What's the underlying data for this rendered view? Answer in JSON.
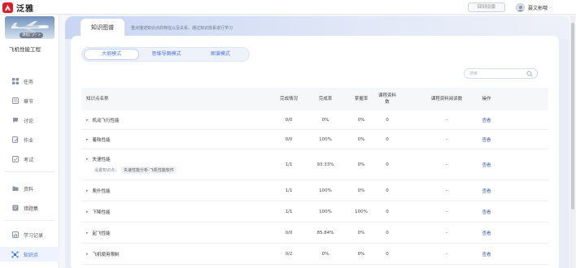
{
  "app": {
    "logo_text": "泛雅"
  },
  "topbar": {
    "back_label": "回到旧版",
    "user_name": "聂文彬哦"
  },
  "sidebar": {
    "course_pill": "课程门户 >",
    "course_title": "飞机性能工程",
    "items": [
      {
        "label": "任务",
        "icon": "grid-icon"
      },
      {
        "label": "章节",
        "icon": "book-icon"
      },
      {
        "label": "讨论",
        "icon": "chat-icon"
      },
      {
        "label": "作业",
        "icon": "edit-icon"
      },
      {
        "label": "考试",
        "icon": "exam-icon"
      },
      {
        "label": "资料",
        "icon": "folder-icon"
      },
      {
        "label": "错题集",
        "icon": "book-icon"
      },
      {
        "label": "学习记录",
        "icon": "record-icon"
      },
      {
        "label": "知识点",
        "icon": "knowledge-icon",
        "active": true
      }
    ]
  },
  "main": {
    "tab_label": "知识图谱",
    "tab_desc": "重点描述知识点的特征以及关系，通过知识体系进行学习",
    "modes": [
      "大纲模式",
      "思维导图模式",
      "图谱模式"
    ],
    "selected_mode": "大纲模式",
    "search_placeholder": "搜索"
  },
  "table": {
    "headers": [
      "知识点名称",
      "完成情况",
      "完成率",
      "掌握率",
      "课程资料数",
      "课程资料阅读数",
      "操作"
    ],
    "rows": [
      {
        "name": "机动飞行性能",
        "done": "0/0",
        "rate": "0%",
        "mastery": "0%",
        "materials": "0",
        "reads": "-",
        "action": "查看"
      },
      {
        "name": "着陆性能",
        "done": "0/0",
        "rate": "100%",
        "mastery": "0%",
        "materials": "0",
        "reads": "-",
        "action": "查看"
      },
      {
        "name": "失速性能",
        "done": "1/1",
        "rate": "93.33%",
        "mastery": "0%",
        "materials": "0",
        "reads": "-",
        "action": "查看",
        "sub_label": "设置知识点：",
        "sub_tag": "失速性能分析-飞机性能软件"
      },
      {
        "name": "爬升性能",
        "done": "1/1",
        "rate": "100%",
        "mastery": "0%",
        "materials": "0",
        "reads": "-",
        "action": "查看"
      },
      {
        "name": "下降性能",
        "done": "1/1",
        "rate": "100%",
        "mastery": "100%",
        "materials": "0",
        "reads": "-",
        "action": "查看"
      },
      {
        "name": "起飞性能",
        "done": "0/0",
        "rate": "85.84%",
        "mastery": "0%",
        "materials": "0",
        "reads": "-",
        "action": "查看"
      },
      {
        "name": "飞机使用限制",
        "done": "0/2",
        "rate": "0%",
        "mastery": "0%",
        "materials": "0",
        "reads": "-",
        "action": "查看"
      }
    ]
  },
  "colors": {
    "accent": "#3d6ff5",
    "brand": "#d6202e",
    "link": "#3f5fa8"
  }
}
